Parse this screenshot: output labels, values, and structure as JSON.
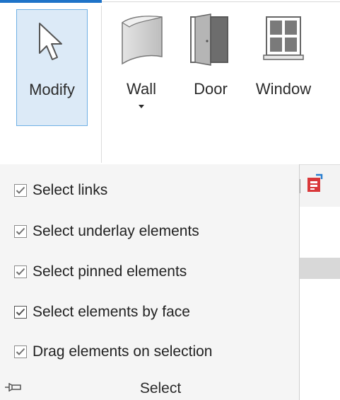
{
  "ribbon": {
    "tools": {
      "modify": {
        "label": "Modify",
        "icon": "cursor-arrow-icon",
        "selected": true
      },
      "wall": {
        "label": "Wall",
        "icon": "wall-icon",
        "has_dropdown": true
      },
      "door": {
        "label": "Door",
        "icon": "door-icon"
      },
      "window": {
        "label": "Window",
        "icon": "window-icon"
      }
    },
    "accent_color": "#1e73c8",
    "selected_bg": "#dceaf7"
  },
  "select_panel": {
    "title": "Select",
    "pin_icon": "pin-icon",
    "options": [
      {
        "label": "Select links",
        "checked": true
      },
      {
        "label": "Select underlay elements",
        "checked": true
      },
      {
        "label": "Select pinned elements",
        "checked": true
      },
      {
        "label": "Select elements by face",
        "checked": true
      },
      {
        "label": "Drag elements on selection",
        "checked": true
      }
    ]
  }
}
